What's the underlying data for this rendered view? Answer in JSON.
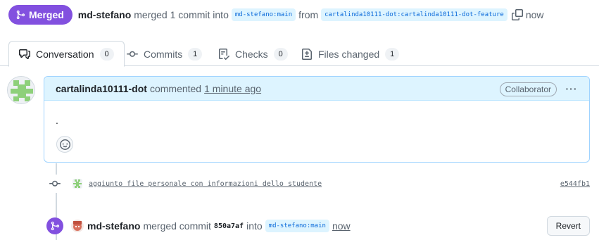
{
  "header": {
    "state_label": "Merged",
    "author": "md-stefano",
    "action_text": "merged 1 commit into",
    "base_branch": "md-stefano:main",
    "from_text": "from",
    "head_branch": "cartalinda10111-dot:cartalinda10111-dot-feature",
    "time": "now",
    "state_color": "#8250df"
  },
  "tabs": [
    {
      "label": "Conversation",
      "count": "0",
      "icon": "comment-discussion-icon",
      "selected": true
    },
    {
      "label": "Commits",
      "count": "1",
      "icon": "git-commit-icon",
      "selected": false
    },
    {
      "label": "Checks",
      "count": "0",
      "icon": "checklist-icon",
      "selected": false
    },
    {
      "label": "Files changed",
      "count": "1",
      "icon": "file-diff-icon",
      "selected": false
    }
  ],
  "comment": {
    "author": "cartalinda10111-dot",
    "action": "commented",
    "time": "1 minute ago",
    "role_badge": "Collaborator",
    "more_label": "···",
    "body": "."
  },
  "commit": {
    "message": "aggiunto file personale con informazioni dello studente",
    "sha": "e544fb1"
  },
  "merge_event": {
    "author": "md-stefano",
    "action": "merged commit",
    "sha": "850a7af",
    "into_text": "into",
    "branch": "md-stefano:main",
    "time": "now",
    "revert_label": "Revert"
  }
}
